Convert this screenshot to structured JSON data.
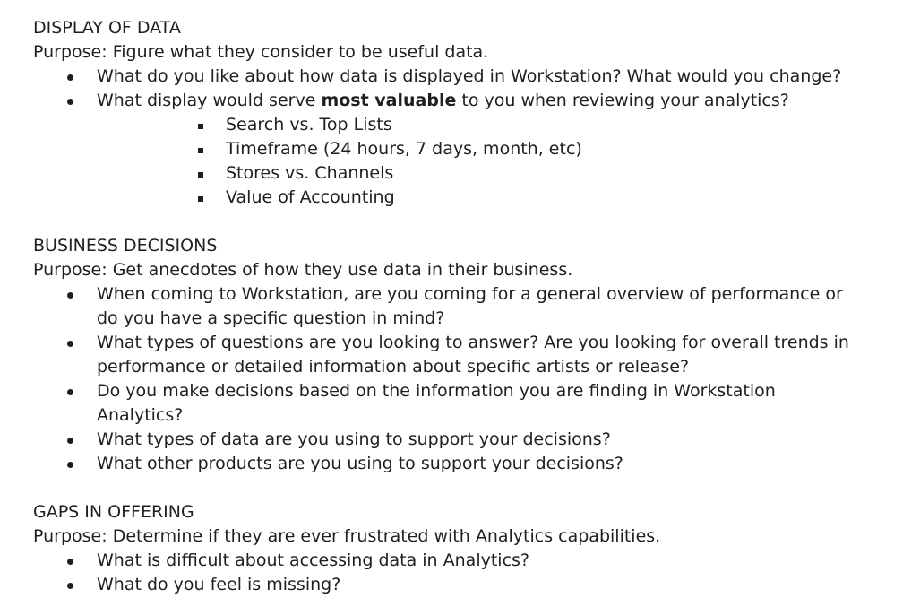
{
  "sections": [
    {
      "heading": "DISPLAY OF DATA",
      "purpose": "Purpose: Figure what they consider to be useful data.",
      "bullets": [
        "What do you like about how data is displayed in Workstation? What would you change?",
        {
          "before": "What display would serve ",
          "bold": "most valuable",
          "after": " to you when reviewing your analytics?"
        }
      ],
      "sub_bullets": [
        "Search vs. Top Lists",
        "Timeframe (24 hours, 7 days, month, etc)",
        "Stores vs. Channels",
        "Value of Accounting"
      ]
    },
    {
      "heading": "BUSINESS DECISIONS",
      "purpose": "Purpose: Get anecdotes of how they use data in their business.",
      "bullets": [
        "When coming to Workstation, are you coming for a general overview of performance or do you have a specific question in mind?",
        "What types of questions are you looking to answer? Are you looking for overall trends in performance or detailed information about specific artists or release?",
        "Do you make decisions based on the information you are finding in Workstation Analytics?",
        "What types of data are you using to support your decisions?",
        "What other products are you using to support your decisions?"
      ]
    },
    {
      "heading": "GAPS IN OFFERING",
      "purpose": "Purpose: Determine if they are ever frustrated with Analytics capabilities.",
      "bullets": [
        "What is difficult about accessing data in Analytics?",
        "What do you feel is missing?"
      ]
    }
  ]
}
